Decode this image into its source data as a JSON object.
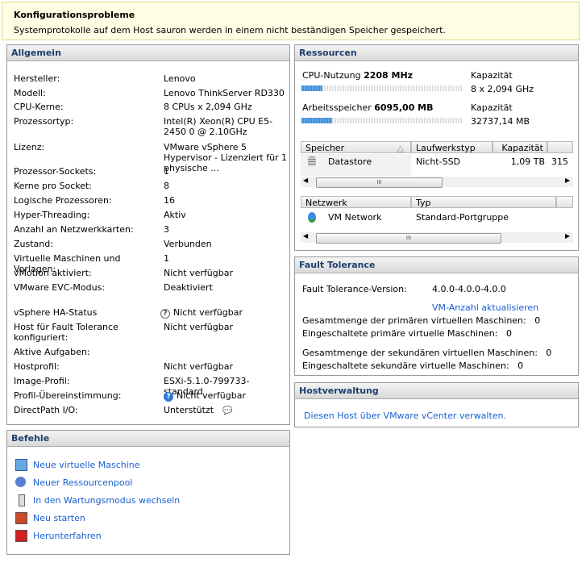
{
  "banner": {
    "title": "Konfigurationsprobleme",
    "message": "Systemprotokolle auf dem Host sauron werden in einem nicht beständigen Speicher gespeichert."
  },
  "general": {
    "title": "Allgemein",
    "rows": [
      {
        "label": "Hersteller:",
        "value": "Lenovo"
      },
      {
        "label": "Modell:",
        "value": "Lenovo ThinkServer RD330"
      },
      {
        "label": "CPU-Kerne:",
        "value": "8 CPUs x 2,094 GHz"
      },
      {
        "label": "Prozessortyp:",
        "value": "Intel(R) Xeon(R) CPU E5-2450 0 @ 2.10GHz"
      },
      {
        "label": "Lizenz:",
        "value": "VMware vSphere 5 Hypervisor - Lizenziert für 1 physische ..."
      },
      {
        "label": "Prozessor-Sockets:",
        "value": "1"
      },
      {
        "label": "Kerne pro Socket:",
        "value": "8"
      },
      {
        "label": "Logische Prozessoren:",
        "value": "16"
      },
      {
        "label": "Hyper-Threading:",
        "value": "Aktiv"
      },
      {
        "label": "Anzahl an Netzwerkkarten:",
        "value": "3"
      },
      {
        "label": "Zustand:",
        "value": "Verbunden"
      },
      {
        "label": "Virtuelle Maschinen und Vorlagen:",
        "value": "1"
      },
      {
        "label": "vMotion aktiviert:",
        "value": "Nicht verfügbar"
      },
      {
        "label": "VMware EVC-Modus:",
        "value": "Deaktiviert"
      },
      {
        "label": "vSphere HA-Status",
        "value": "Nicht verfügbar"
      },
      {
        "label": "Host für Fault Tolerance konfiguriert:",
        "value": "Nicht verfügbar"
      },
      {
        "label": "Aktive Aufgaben:",
        "value": ""
      },
      {
        "label": "Hostprofil:",
        "value": "Nicht verfügbar"
      },
      {
        "label": "Image-Profil:",
        "value": "ESXi-5.1.0-799733-standard"
      },
      {
        "label": "Profil-Übereinstimmung:",
        "value": "Nicht verfügbar"
      },
      {
        "label": "DirectPath I/O:",
        "value": "Unterstützt"
      }
    ]
  },
  "commands": {
    "title": "Befehle",
    "items": [
      {
        "label": "Neue virtuelle Maschine",
        "icon": "new-vm-icon"
      },
      {
        "label": "Neuer Ressourcenpool",
        "icon": "new-resource-pool-icon"
      },
      {
        "label": "In den Wartungsmodus wechseln",
        "icon": "wrench-icon"
      },
      {
        "label": "Neu starten",
        "icon": "restart-icon"
      },
      {
        "label": "Herunterfahren",
        "icon": "shutdown-icon"
      }
    ]
  },
  "resources": {
    "title": "Ressourcen",
    "cpu": {
      "label": "CPU-Nutzung",
      "value": "2208 MHz",
      "capacity_label": "Kapazität",
      "capacity": "8 x 2,094 GHz",
      "usage_percent": 13
    },
    "memory": {
      "label": "Arbeitsspeicher",
      "value": "6095,00 MB",
      "capacity_label": "Kapazität",
      "capacity": "32737,14 MB",
      "usage_percent": 19
    },
    "storage": {
      "headers": [
        "Speicher",
        "Laufwerkstyp",
        "Kapazität"
      ],
      "rows": [
        {
          "name": "Datastore",
          "type": "Nicht-SSD",
          "capacity": "1,09 TB",
          "extra": "315"
        }
      ]
    },
    "network": {
      "headers": [
        "Netzwerk",
        "Typ"
      ],
      "rows": [
        {
          "name": "VM Network",
          "type": "Standard-Portgruppe"
        }
      ]
    }
  },
  "fault_tolerance": {
    "title": "Fault Tolerance",
    "version_label": "Fault Tolerance-Version:",
    "version": "4.0.0-4.0.0-4.0.0",
    "refresh_link": "VM-Anzahl aktualisieren",
    "rows": [
      {
        "label": "Gesamtmenge der primären virtuellen Maschinen:",
        "value": "0"
      },
      {
        "label": "Eingeschaltete primäre virtuelle Maschinen:",
        "value": "0"
      },
      {
        "label": "Gesamtmenge der sekundären virtuellen Maschinen:",
        "value": "0"
      },
      {
        "label": "Eingeschaltete sekundäre virtuelle Maschinen:",
        "value": "0"
      }
    ]
  },
  "host_management": {
    "title": "Hostverwaltung",
    "link": "Diesen Host über VMware vCenter verwalten."
  }
}
